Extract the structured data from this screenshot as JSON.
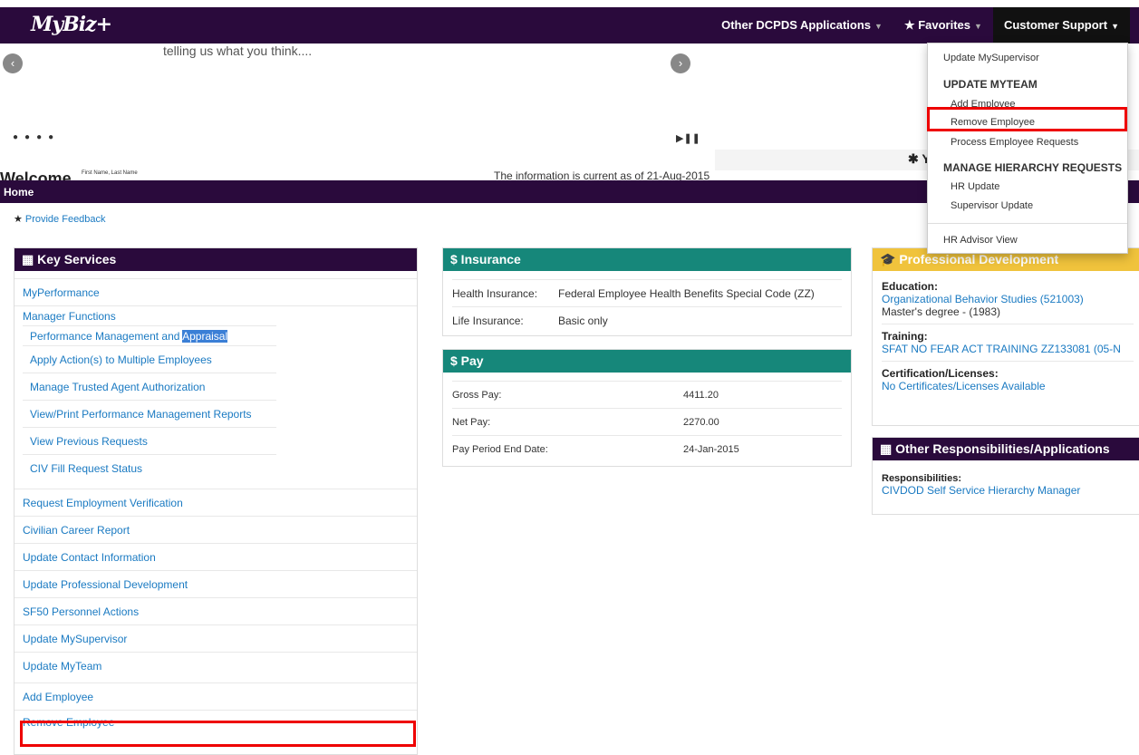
{
  "header": {
    "logo": "MyBiz+",
    "nav": [
      {
        "label": "Other DCPDS Applications"
      },
      {
        "label": "★ Favorites"
      },
      {
        "label": "Customer Support"
      }
    ]
  },
  "carousel": {
    "text": "telling us what you think....",
    "welcome": "Welcome,",
    "username": "First Name, Last Name",
    "current_info": "The information is current as of 21-Aug-2015",
    "right_partial": "✱ Y"
  },
  "dropdown": {
    "update_mysupervisor": "Update MySupervisor",
    "update_myteam_header": "UPDATE MYTEAM",
    "add_employee": "Add Employee",
    "remove_employee": "Remove Employee",
    "process_requests": "Process Employee Requests",
    "manage_hierarchy_header": "MANAGE HIERARCHY REQUESTS",
    "hr_update": "HR Update",
    "supervisor_update": "Supervisor Update",
    "hr_advisor_view": "HR Advisor View"
  },
  "homebar": {
    "label": "Home"
  },
  "feedback": {
    "label": "Provide Feedback"
  },
  "key_services": {
    "title": "Key Services",
    "my_performance": "MyPerformance",
    "manager_functions": "Manager Functions",
    "perf_mgmt_a": "Performance Management and ",
    "perf_mgmt_b": "Appraisal",
    "apply_action": "Apply Action(s) to Multiple Employees",
    "manage_trusted": "Manage Trusted Agent Authorization",
    "view_print": "View/Print Performance Management Reports",
    "view_previous": "View Previous Requests",
    "civ_fill": "CIV Fill Request Status",
    "req_employment": "Request Employment Verification",
    "civilian_career": "Civilian Career Report",
    "update_contact": "Update Contact Information",
    "update_prof_dev": "Update Professional Development",
    "sf50": "SF50 Personnel Actions",
    "update_mysupervisor": "Update MySupervisor",
    "update_myteam": "Update MyTeam",
    "add_employee": "Add Employee",
    "remove_employee": "Remove Employee"
  },
  "insurance": {
    "title": "$ Insurance",
    "health_label": "Health Insurance:",
    "health_value": "Federal Employee Health Benefits Special Code (ZZ)",
    "life_label": "Life Insurance:",
    "life_value": "Basic only"
  },
  "pay": {
    "title": "$ Pay",
    "gross_label": "Gross Pay:",
    "gross_value": "4411.20",
    "net_label": "Net Pay:",
    "net_value": "2270.00",
    "period_label": "Pay Period End Date:",
    "period_value": "24-Jan-2015"
  },
  "prof_dev": {
    "title": "Professional Development",
    "education_label": "Education:",
    "education_link": "Organizational Behavior Studies (521003)",
    "education_degree": "Master's degree - (1983)",
    "training_label": "Training:",
    "training_link": "SFAT NO FEAR ACT TRAINING ZZ133081 (05-N",
    "cert_label": "Certification/Licenses:",
    "cert_link": "No Certificates/Licenses Available"
  },
  "other_resp": {
    "title": "Other Responsibilities/Applications",
    "resp_label": "Responsibilities:",
    "resp_link": "CIVDOD Self Service Hierarchy Manager"
  }
}
